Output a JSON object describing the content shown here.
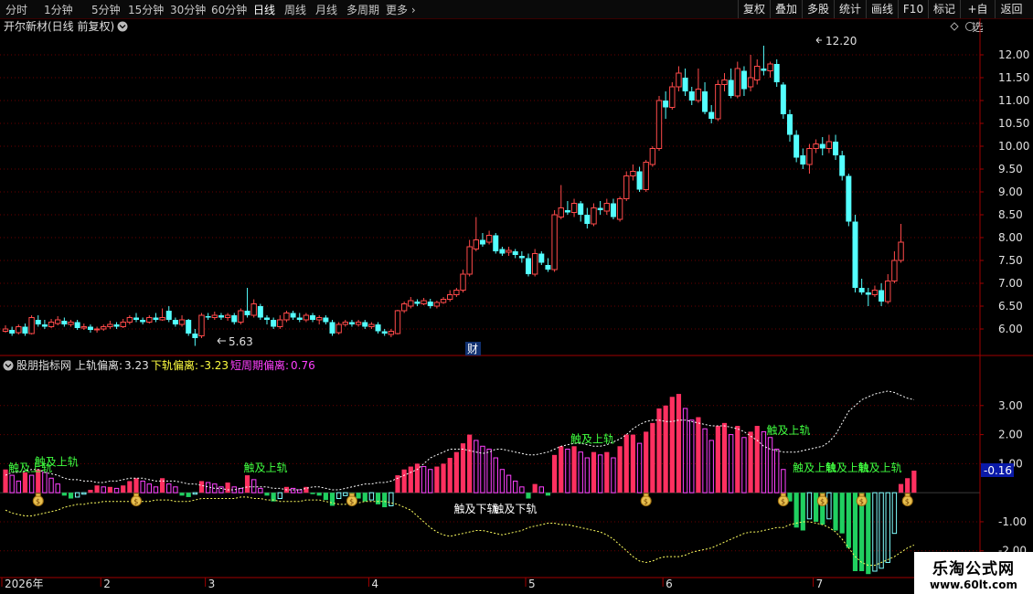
{
  "toolbar": {
    "periods": [
      "分时",
      "1分钟",
      "5分钟",
      "15分钟",
      "30分钟",
      "60分钟",
      "日线",
      "周线",
      "月线",
      "多周期",
      "更多"
    ],
    "active_period": "日线",
    "right_buttons": [
      "复权",
      "叠加",
      "多股",
      "统计",
      "画线",
      "F10",
      "标记",
      "+自选",
      "返回"
    ]
  },
  "stock": {
    "title": "开尔新材(日线 前复权)",
    "max_label": "12.20",
    "min_label": "5.63",
    "marker": "财"
  },
  "price_axis": {
    "ticks": [
      "12.00",
      "11.50",
      "11.00",
      "10.50",
      "10.00",
      "9.50",
      "9.00",
      "8.50",
      "8.00",
      "7.50",
      "7.00",
      "6.50",
      "6.00"
    ],
    "ticks_values": [
      12.0,
      11.5,
      11.0,
      10.5,
      10.0,
      9.5,
      9.0,
      8.5,
      8.0,
      7.5,
      7.0,
      6.5,
      6.0
    ]
  },
  "indicator": {
    "name": "股朋指标网",
    "upper_label": "上轨偏离:",
    "upper_value": "3.23",
    "lower_label": "下轨偏离:",
    "lower_value": "-3.23",
    "short_label": "短周期偏离:",
    "short_value": "0.76",
    "current_value": "-0.16",
    "ticks": [
      "3.00",
      "2.00",
      "1.00",
      "-1.00",
      "-2.00"
    ],
    "ticks_values": [
      3,
      2,
      1,
      -1,
      -2
    ],
    "touch_upper": "触及上轨",
    "touch_lower": "触及下轨"
  },
  "date_axis": {
    "labels": [
      "2026年",
      "2",
      "3",
      "4",
      "5",
      "6",
      "7"
    ]
  },
  "watermark": {
    "line1": "乐淘公式网",
    "line2": "www.60lt.com"
  },
  "colors": {
    "up": "#ff4a4a",
    "down": "#54ffff",
    "grid": "#6a0000",
    "bar_up": "#ff3060",
    "bar_up_strong": "#ff40ff",
    "bar_down": "#20d060",
    "bar_down_strong": "#80ffff",
    "label_green": "#40ff40",
    "label_yellow": "#ffff40",
    "label_magenta": "#ff40ff"
  },
  "chart_data": {
    "type": "candlestick",
    "price_axis_range": [
      5.6,
      12.4
    ],
    "candles": [
      [
        5.95,
        6.0,
        6.08,
        5.92
      ],
      [
        5.98,
        5.9,
        6.05,
        5.85
      ],
      [
        5.92,
        6.05,
        6.1,
        5.88
      ],
      [
        6.05,
        5.9,
        6.12,
        5.85
      ],
      [
        5.9,
        6.25,
        6.3,
        5.88
      ],
      [
        6.2,
        6.1,
        6.3,
        6.05
      ],
      [
        6.1,
        6.05,
        6.2,
        6.0
      ],
      [
        6.05,
        6.15,
        6.22,
        6.02
      ],
      [
        6.12,
        6.2,
        6.28,
        6.08
      ],
      [
        6.18,
        6.1,
        6.25,
        6.05
      ],
      [
        6.1,
        6.15,
        6.2,
        6.05
      ],
      [
        6.15,
        6.02,
        6.2,
        5.98
      ],
      [
        6.02,
        6.05,
        6.12,
        5.98
      ],
      [
        6.05,
        5.98,
        6.1,
        5.92
      ],
      [
        5.98,
        6.0,
        6.05,
        5.92
      ],
      [
        6.0,
        6.05,
        6.1,
        5.96
      ],
      [
        6.05,
        6.1,
        6.18,
        6.0
      ],
      [
        6.1,
        6.05,
        6.15,
        6.0
      ],
      [
        6.05,
        6.15,
        6.22,
        6.02
      ],
      [
        6.15,
        6.25,
        6.3,
        6.1
      ],
      [
        6.25,
        6.2,
        6.35,
        6.15
      ],
      [
        6.2,
        6.15,
        6.25,
        6.1
      ],
      [
        6.15,
        6.25,
        6.3,
        6.12
      ],
      [
        6.25,
        6.2,
        6.35,
        6.15
      ],
      [
        6.2,
        6.25,
        6.45,
        6.18
      ],
      [
        6.4,
        6.2,
        6.5,
        6.15
      ],
      [
        6.2,
        6.1,
        6.25,
        6.05
      ],
      [
        6.1,
        6.2,
        6.3,
        6.05
      ],
      [
        6.2,
        5.9,
        6.22,
        5.85
      ],
      [
        5.9,
        5.8,
        6.0,
        5.63
      ],
      [
        5.85,
        6.3,
        6.35,
        5.8
      ],
      [
        6.28,
        6.25,
        6.35,
        6.2
      ],
      [
        6.25,
        6.3,
        6.38,
        6.2
      ],
      [
        6.3,
        6.25,
        6.35,
        6.2
      ],
      [
        6.25,
        6.3,
        6.35,
        6.18
      ],
      [
        6.3,
        6.15,
        6.35,
        6.1
      ],
      [
        6.15,
        6.4,
        6.45,
        6.1
      ],
      [
        6.4,
        6.3,
        6.9,
        6.25
      ],
      [
        6.3,
        6.55,
        6.65,
        6.25
      ],
      [
        6.5,
        6.25,
        6.55,
        6.2
      ],
      [
        6.25,
        6.2,
        6.3,
        6.1
      ],
      [
        6.2,
        6.05,
        6.25,
        6.0
      ],
      [
        6.05,
        6.2,
        6.3,
        6.0
      ],
      [
        6.2,
        6.35,
        6.4,
        6.15
      ],
      [
        6.35,
        6.25,
        6.4,
        6.2
      ],
      [
        6.25,
        6.2,
        6.35,
        6.15
      ],
      [
        6.2,
        6.3,
        6.35,
        6.15
      ],
      [
        6.3,
        6.2,
        6.35,
        6.15
      ],
      [
        6.2,
        6.25,
        6.3,
        6.1
      ],
      [
        6.25,
        6.15,
        6.3,
        6.1
      ],
      [
        6.15,
        5.9,
        6.2,
        5.85
      ],
      [
        5.92,
        6.1,
        6.15,
        5.88
      ],
      [
        6.1,
        6.15,
        6.2,
        6.05
      ],
      [
        6.15,
        6.1,
        6.2,
        6.05
      ],
      [
        6.1,
        6.15,
        6.2,
        6.05
      ],
      [
        6.15,
        6.05,
        6.2,
        6.0
      ],
      [
        6.05,
        6.1,
        6.15,
        6.0
      ],
      [
        6.1,
        5.95,
        6.15,
        5.9
      ],
      [
        5.95,
        5.9,
        6.0,
        5.85
      ],
      [
        5.88,
        5.95,
        6.0,
        5.82
      ],
      [
        5.9,
        6.4,
        6.42,
        5.88
      ],
      [
        6.4,
        6.55,
        6.6,
        6.35
      ],
      [
        6.5,
        6.62,
        6.7,
        6.45
      ],
      [
        6.6,
        6.55,
        6.65,
        6.5
      ],
      [
        6.55,
        6.62,
        6.68,
        6.52
      ],
      [
        6.6,
        6.5,
        6.66,
        6.45
      ],
      [
        6.5,
        6.58,
        6.62,
        6.45
      ],
      [
        6.58,
        6.65,
        6.7,
        6.55
      ],
      [
        6.65,
        6.75,
        6.85,
        6.6
      ],
      [
        6.75,
        6.85,
        6.9,
        6.7
      ],
      [
        6.85,
        7.2,
        7.3,
        6.8
      ],
      [
        7.2,
        7.8,
        7.95,
        7.15
      ],
      [
        7.75,
        7.95,
        8.45,
        7.7
      ],
      [
        7.95,
        7.85,
        8.1,
        7.8
      ],
      [
        7.9,
        8.05,
        8.15,
        7.85
      ],
      [
        8.05,
        7.7,
        8.1,
        7.65
      ],
      [
        7.75,
        7.65,
        7.8,
        7.6
      ],
      [
        7.68,
        7.72,
        7.8,
        7.6
      ],
      [
        7.7,
        7.62,
        7.75,
        7.55
      ],
      [
        7.6,
        7.55,
        7.7,
        7.45
      ],
      [
        7.55,
        7.2,
        7.65,
        7.15
      ],
      [
        7.2,
        7.65,
        7.75,
        7.15
      ],
      [
        7.65,
        7.45,
        7.7,
        7.4
      ],
      [
        7.4,
        7.3,
        7.55,
        7.25
      ],
      [
        7.3,
        8.5,
        8.6,
        7.25
      ],
      [
        8.45,
        8.65,
        9.15,
        8.4
      ],
      [
        8.6,
        8.55,
        8.8,
        8.5
      ],
      [
        8.55,
        8.75,
        8.85,
        8.45
      ],
      [
        8.75,
        8.5,
        8.8,
        8.35
      ],
      [
        8.5,
        8.3,
        8.65,
        8.2
      ],
      [
        8.3,
        8.65,
        8.75,
        8.25
      ],
      [
        8.65,
        8.6,
        8.8,
        8.5
      ],
      [
        8.58,
        8.75,
        8.85,
        8.5
      ],
      [
        8.75,
        8.45,
        8.85,
        8.4
      ],
      [
        8.4,
        8.85,
        8.9,
        8.35
      ],
      [
        8.85,
        9.35,
        9.45,
        8.8
      ],
      [
        9.35,
        9.45,
        9.6,
        9.25
      ],
      [
        9.45,
        9.05,
        9.55,
        9.0
      ],
      [
        9.05,
        9.65,
        9.7,
        9.0
      ],
      [
        9.6,
        9.95,
        10.0,
        9.55
      ],
      [
        9.95,
        11.0,
        11.1,
        9.9
      ],
      [
        11.0,
        10.85,
        11.2,
        10.6
      ],
      [
        10.85,
        11.3,
        11.4,
        10.8
      ],
      [
        11.3,
        11.6,
        11.75,
        11.2
      ],
      [
        11.5,
        11.2,
        11.7,
        11.1
      ],
      [
        11.2,
        11.0,
        11.3,
        10.9
      ],
      [
        11.0,
        11.25,
        11.7,
        10.95
      ],
      [
        11.2,
        10.75,
        11.4,
        10.7
      ],
      [
        10.75,
        10.6,
        10.9,
        10.5
      ],
      [
        10.6,
        11.35,
        11.45,
        10.55
      ],
      [
        11.35,
        11.45,
        11.6,
        11.2
      ],
      [
        11.45,
        11.1,
        11.7,
        11.05
      ],
      [
        11.1,
        11.7,
        11.85,
        11.05
      ],
      [
        11.65,
        11.25,
        11.75,
        11.1
      ],
      [
        11.3,
        11.5,
        12.0,
        11.2
      ],
      [
        11.45,
        11.75,
        11.9,
        11.35
      ],
      [
        11.7,
        11.65,
        12.2,
        11.55
      ],
      [
        11.65,
        11.8,
        11.85,
        11.5
      ],
      [
        11.8,
        11.4,
        11.9,
        11.3
      ],
      [
        11.35,
        10.7,
        11.4,
        10.6
      ],
      [
        10.7,
        10.25,
        10.8,
        10.1
      ],
      [
        10.25,
        9.75,
        10.35,
        9.65
      ],
      [
        9.8,
        9.6,
        9.95,
        9.5
      ],
      [
        9.6,
        9.95,
        10.05,
        9.4
      ],
      [
        9.95,
        10.05,
        10.15,
        9.85
      ],
      [
        10.05,
        9.95,
        10.2,
        9.8
      ],
      [
        9.95,
        10.1,
        10.25,
        9.85
      ],
      [
        10.1,
        9.8,
        10.25,
        9.7
      ],
      [
        9.8,
        9.35,
        9.9,
        9.25
      ],
      [
        9.35,
        8.35,
        9.4,
        8.25
      ],
      [
        8.35,
        6.9,
        8.5,
        6.8
      ],
      [
        6.9,
        6.8,
        7.1,
        6.75
      ],
      [
        6.8,
        6.75,
        6.9,
        6.5
      ],
      [
        6.75,
        6.85,
        6.95,
        6.7
      ],
      [
        6.85,
        6.6,
        7.0,
        6.5
      ],
      [
        6.6,
        7.05,
        7.2,
        6.55
      ],
      [
        7.05,
        7.5,
        7.7,
        7.0
      ],
      [
        7.5,
        7.9,
        8.3,
        7.45
      ]
    ],
    "indicator_range": [
      -2.7,
      4.0
    ],
    "bars": [
      0.8,
      0.6,
      0.4,
      0.7,
      0.6,
      0.8,
      0.7,
      0.5,
      0.3,
      -0.1,
      -0.2,
      -0.15,
      -0.05,
      0.1,
      0.25,
      0.2,
      0.2,
      0.15,
      0.25,
      0.4,
      0.5,
      0.4,
      0.3,
      0.2,
      0.5,
      0.3,
      0.2,
      -0.1,
      -0.15,
      -0.05,
      0.4,
      0.35,
      0.3,
      0.2,
      0.35,
      0.2,
      0.15,
      0.6,
      0.45,
      0.15,
      -0.1,
      -0.3,
      -0.2,
      0.2,
      0.15,
      0.1,
      0.2,
      -0.05,
      -0.1,
      -0.25,
      -0.45,
      -0.2,
      -0.1,
      -0.15,
      -0.2,
      -0.3,
      -0.25,
      -0.4,
      -0.5,
      -0.45,
      0.6,
      0.8,
      0.9,
      1.0,
      0.9,
      0.8,
      0.9,
      1.0,
      1.2,
      1.4,
      1.7,
      2.0,
      1.8,
      1.6,
      1.5,
      1.2,
      0.8,
      0.6,
      0.4,
      0.2,
      -0.2,
      0.3,
      0.2,
      -0.1,
      1.3,
      1.6,
      1.5,
      1.6,
      1.4,
      1.2,
      1.4,
      1.3,
      1.4,
      1.2,
      1.6,
      2.0,
      2.0,
      1.7,
      2.1,
      2.4,
      2.9,
      3.0,
      3.3,
      3.4,
      2.9,
      2.5,
      2.6,
      2.2,
      1.8,
      2.3,
      2.4,
      2.0,
      2.3,
      1.9,
      2.1,
      2.3,
      2.1,
      1.9,
      1.5,
      0.8,
      -0.3,
      -1.2,
      -1.3,
      -0.9,
      -1.0,
      -1.1,
      -0.9,
      -1.3,
      -1.4,
      -1.9,
      -2.7,
      -2.7,
      -2.8,
      -2.7,
      -2.6,
      -2.4,
      -1.4,
      0.3,
      0.5,
      0.76
    ],
    "upper_band": [
      0.6,
      0.7,
      0.7,
      0.75,
      0.8,
      0.8,
      0.7,
      0.65,
      0.6,
      0.5,
      0.45,
      0.45,
      0.4,
      0.4,
      0.35,
      0.35,
      0.4,
      0.4,
      0.45,
      0.5,
      0.5,
      0.5,
      0.45,
      0.4,
      0.4,
      0.4,
      0.4,
      0.35,
      0.3,
      0.3,
      0.25,
      0.2,
      0.15,
      0.15,
      0.1,
      0.1,
      0.15,
      0.2,
      0.2,
      0.2,
      0.2,
      0.15,
      0.15,
      0.1,
      0.1,
      0.1,
      0.15,
      0.2,
      0.2,
      0.15,
      0.1,
      0.1,
      0.15,
      0.2,
      0.25,
      0.3,
      0.3,
      0.35,
      0.35,
      0.4,
      0.5,
      0.6,
      0.7,
      0.8,
      1.0,
      1.2,
      1.3,
      1.4,
      1.5,
      1.5,
      1.5,
      1.45,
      1.4,
      1.35,
      1.4,
      1.5,
      1.5,
      1.45,
      1.4,
      1.35,
      1.3,
      1.3,
      1.35,
      1.4,
      1.5,
      1.6,
      1.65,
      1.7,
      1.7,
      1.65,
      1.6,
      1.6,
      1.65,
      1.75,
      1.85,
      2.0,
      2.2,
      2.35,
      2.45,
      2.5,
      2.5,
      2.45,
      2.45,
      2.5,
      2.5,
      2.45,
      2.4,
      2.35,
      2.3,
      2.3,
      2.3,
      2.25,
      2.2,
      2.1,
      1.95,
      1.8,
      1.6,
      1.5,
      1.45,
      1.4,
      1.4,
      1.4,
      1.45,
      1.5,
      1.55,
      1.6,
      1.75,
      2.0,
      2.4,
      2.8,
      3.0,
      3.2,
      3.3,
      3.4,
      3.45,
      3.5,
      3.45,
      3.35,
      3.25,
      3.2
    ],
    "lower_band": [
      -0.6,
      -0.7,
      -0.75,
      -0.8,
      -0.8,
      -0.75,
      -0.7,
      -0.65,
      -0.6,
      -0.5,
      -0.45,
      -0.4,
      -0.4,
      -0.35,
      -0.35,
      -0.3,
      -0.3,
      -0.3,
      -0.3,
      -0.3,
      -0.3,
      -0.3,
      -0.3,
      -0.25,
      -0.25,
      -0.25,
      -0.3,
      -0.3,
      -0.3,
      -0.25,
      -0.2,
      -0.2,
      -0.2,
      -0.2,
      -0.2,
      -0.2,
      -0.15,
      -0.15,
      -0.2,
      -0.2,
      -0.25,
      -0.25,
      -0.3,
      -0.3,
      -0.3,
      -0.3,
      -0.25,
      -0.25,
      -0.25,
      -0.3,
      -0.35,
      -0.4,
      -0.4,
      -0.35,
      -0.35,
      -0.3,
      -0.3,
      -0.3,
      -0.3,
      -0.35,
      -0.4,
      -0.5,
      -0.6,
      -0.8,
      -1.0,
      -1.2,
      -1.35,
      -1.45,
      -1.5,
      -1.45,
      -1.4,
      -1.35,
      -1.3,
      -1.3,
      -1.35,
      -1.4,
      -1.45,
      -1.4,
      -1.35,
      -1.3,
      -1.2,
      -1.15,
      -1.1,
      -1.05,
      -1.05,
      -1.1,
      -1.1,
      -1.15,
      -1.2,
      -1.25,
      -1.3,
      -1.35,
      -1.45,
      -1.6,
      -1.8,
      -2.0,
      -2.2,
      -2.35,
      -2.4,
      -2.35,
      -2.25,
      -2.2,
      -2.2,
      -2.2,
      -2.15,
      -2.05,
      -2.0,
      -1.95,
      -1.9,
      -1.8,
      -1.7,
      -1.6,
      -1.5,
      -1.4,
      -1.35,
      -1.35,
      -1.3,
      -1.25,
      -1.2,
      -1.2,
      -1.1,
      -1.05,
      -1.0,
      -1.0,
      -1.05,
      -1.1,
      -1.2,
      -1.35,
      -1.6,
      -1.9,
      -2.2,
      -2.4,
      -2.5,
      -2.5,
      -2.4,
      -2.3,
      -2.2,
      -2.05,
      -1.9,
      -1.8
    ],
    "touch_upper_at": [
      1,
      5,
      37,
      87,
      117,
      121,
      126,
      131
    ],
    "touch_lower_at": [
      70,
      76
    ],
    "money_icons_at": [
      5,
      20,
      53,
      98,
      119,
      125,
      131,
      138
    ]
  }
}
